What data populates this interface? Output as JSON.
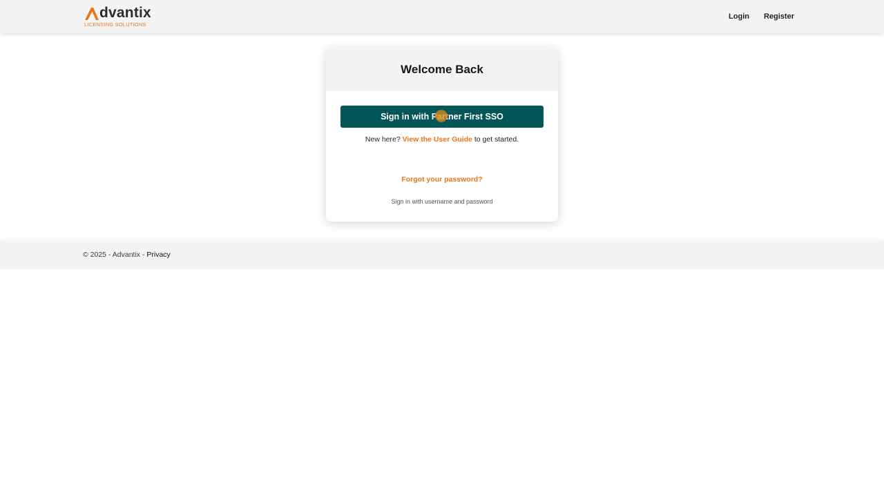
{
  "brand": {
    "name": "dvantix",
    "tagline": "LICENSING SOLUTIONS",
    "accent_color": "#e8751a",
    "icon": "advantix-logo-mark-icon"
  },
  "nav": {
    "login": "Login",
    "register": "Register"
  },
  "card": {
    "title": "Welcome Back",
    "sso_button": "Sign in with Partner First SSO",
    "sso_button_color": "#02565a",
    "new_here_prefix": "New here?",
    "user_guide_link": "View the User Guide",
    "new_here_suffix": "to get started.",
    "forgot_password": "Forgot your password?",
    "username_password": "Sign in with username and password"
  },
  "footer": {
    "copyright": "© 2025 - Advantix -",
    "privacy": "Privacy"
  }
}
